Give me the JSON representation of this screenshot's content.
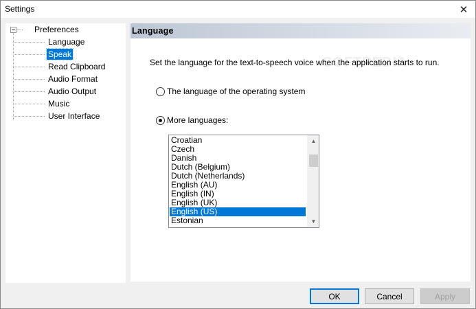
{
  "window": {
    "title": "Settings"
  },
  "tree": {
    "root": "Preferences",
    "items": [
      {
        "label": "Language",
        "selected": false
      },
      {
        "label": "Speak",
        "selected": true
      },
      {
        "label": "Read Clipboard",
        "selected": false
      },
      {
        "label": "Audio Format",
        "selected": false
      },
      {
        "label": "Audio Output",
        "selected": false
      },
      {
        "label": "Music",
        "selected": false
      },
      {
        "label": "User Interface",
        "selected": false
      }
    ]
  },
  "panel": {
    "header": "Language",
    "description": "Set the language for the text-to-speech voice when the application starts to run.",
    "radio_os": {
      "label": "The language of the operating system",
      "checked": false
    },
    "radio_more": {
      "label": "More languages:",
      "checked": true
    },
    "languages": [
      "Croatian",
      "Czech",
      "Danish",
      "Dutch (Belgium)",
      "Dutch (Netherlands)",
      "English (AU)",
      "English (IN)",
      "English (UK)",
      "English (US)",
      "Estonian"
    ],
    "selected_language": "English (US)",
    "watermark": "SOFTPEDIA"
  },
  "buttons": {
    "ok": "OK",
    "cancel": "Cancel",
    "apply": "Apply"
  },
  "colors": {
    "accent": "#0078d7",
    "header_gradient_start": "#bcc6d4"
  }
}
